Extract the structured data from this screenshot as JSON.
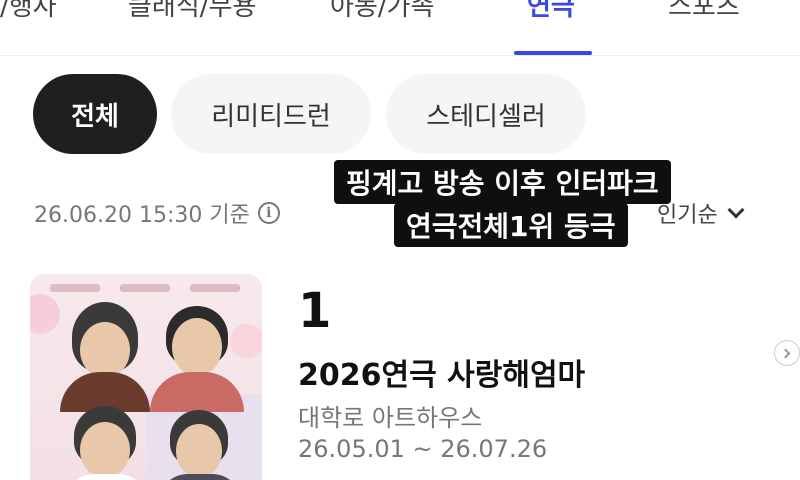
{
  "category_tabs": [
    {
      "label": "/행사",
      "active": false
    },
    {
      "label": "클래식/무용",
      "active": false
    },
    {
      "label": "아동/가족",
      "active": false
    },
    {
      "label": "연극",
      "active": true
    },
    {
      "label": "스포츠",
      "active": false
    }
  ],
  "chips": [
    {
      "label": "전체",
      "active": true
    },
    {
      "label": "리미티드런",
      "active": false
    },
    {
      "label": "스테디셀러",
      "active": false
    }
  ],
  "timestamp": {
    "text": "26.06.20 15:30 기준",
    "icon": "info-icon"
  },
  "sort": {
    "label": "인기순",
    "icon": "chevron-down-icon"
  },
  "caption": {
    "line1": "핑계고 방송 이후 인터파크",
    "line2": "연극전체1위 등극"
  },
  "ranking": [
    {
      "rank": "1",
      "title": "2026연극 사랑해엄마",
      "venue": "대학로 아트하우스",
      "dates": "26.05.01 ~ 26.07.26"
    }
  ],
  "colors": {
    "accent": "#3a47e0",
    "chip_active_bg": "#1f1f1f",
    "chip_inactive_bg": "#f4f5f7",
    "caption_bg": "#0f0f0f"
  }
}
